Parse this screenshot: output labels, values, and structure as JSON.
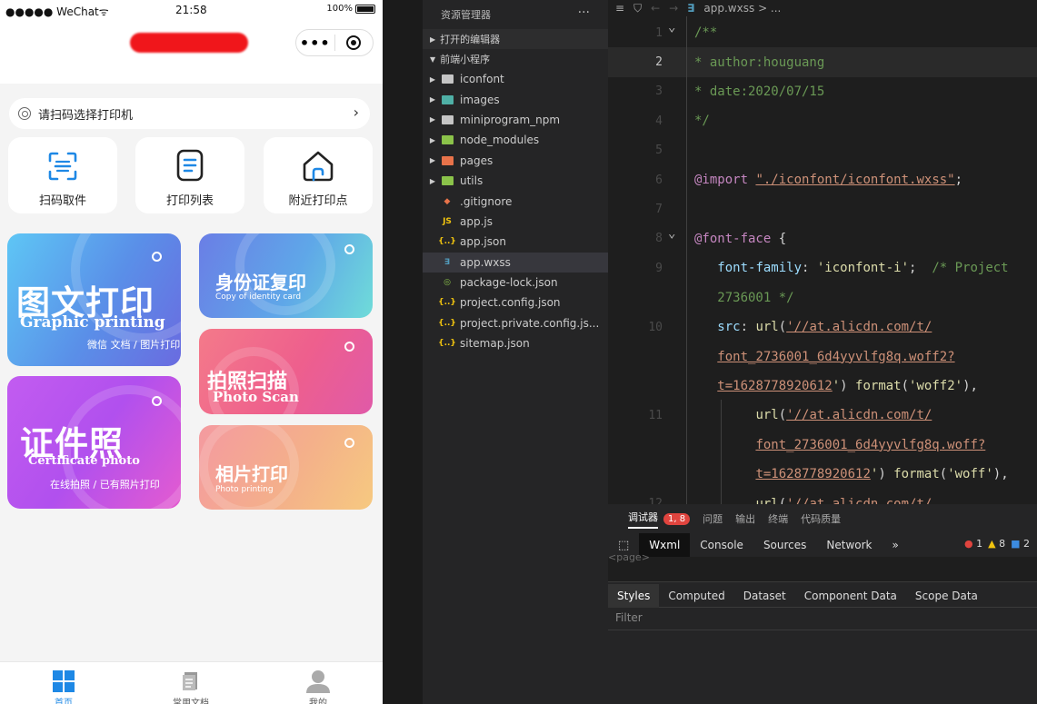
{
  "phone": {
    "status": {
      "carrier": "●●●●● WeChat",
      "wifi": "ᯤ",
      "time": "21:58",
      "battery": "100%"
    },
    "capsule": {
      "dots": "•••"
    },
    "scan_bar": {
      "text": "请扫码选择打印机",
      "chevron": "›"
    },
    "features": [
      {
        "label": "扫码取件",
        "icon": "scan-icon"
      },
      {
        "label": "打印列表",
        "icon": "list-icon"
      },
      {
        "label": "附近打印点",
        "icon": "home-icon"
      }
    ],
    "cards": {
      "graphic": {
        "title": "图文打印",
        "subtitle": "Graphic printing",
        "desc": "微信 文档 / 图片打印"
      },
      "idcopy": {
        "title": "身份证复印",
        "subtitle": "Copy of identity card"
      },
      "photoscan": {
        "title": "拍照扫描",
        "subtitle": "Photo Scan"
      },
      "certificate": {
        "title": "证件照",
        "subtitle": "Certificate photo",
        "desc": "在线拍照 / 已有照片打印"
      },
      "photoprint": {
        "title": "相片打印",
        "subtitle": "Photo printing"
      }
    },
    "tabs": [
      {
        "label": "首页",
        "active": true
      },
      {
        "label": "常用文档",
        "active": false
      },
      {
        "label": "我的",
        "active": false
      }
    ]
  },
  "explorer": {
    "title": "资源管理器",
    "more": "···",
    "open_editors": "打开的编辑器",
    "project": "前端小程序",
    "items": [
      {
        "name": "iconfont",
        "type": "folder",
        "color": "#c5c5c5"
      },
      {
        "name": "images",
        "type": "folder",
        "color": "#4fb0a6"
      },
      {
        "name": "miniprogram_npm",
        "type": "folder",
        "color": "#c5c5c5"
      },
      {
        "name": "node_modules",
        "type": "folder",
        "color": "#8bc34a"
      },
      {
        "name": "pages",
        "type": "folder",
        "color": "#e8734a"
      },
      {
        "name": "utils",
        "type": "folder",
        "color": "#8bc34a"
      },
      {
        "name": ".gitignore",
        "type": "file",
        "icon": "◆",
        "color": "#e8734a"
      },
      {
        "name": "app.js",
        "type": "file",
        "icon": "JS",
        "color": "#f1c40f"
      },
      {
        "name": "app.json",
        "type": "file",
        "icon": "{..}",
        "color": "#f1c40f"
      },
      {
        "name": "app.wxss",
        "type": "file",
        "icon": "∃",
        "color": "#519aba",
        "selected": true
      },
      {
        "name": "package-lock.json",
        "type": "file",
        "icon": "◎",
        "color": "#8bc34a"
      },
      {
        "name": "project.config.json",
        "type": "file",
        "icon": "{..}",
        "color": "#f1c40f"
      },
      {
        "name": "project.private.config.js...",
        "type": "file",
        "icon": "{..}",
        "color": "#f1c40f"
      },
      {
        "name": "sitemap.json",
        "type": "file",
        "icon": "{..}",
        "color": "#f1c40f"
      }
    ]
  },
  "editor": {
    "breadcrumb": {
      "file": "app.wxss",
      "rest": "> ..."
    },
    "lines": [
      {
        "n": "1",
        "fold": true,
        "parts": [
          [
            "c-com",
            "/**"
          ]
        ]
      },
      {
        "n": "2",
        "current": true,
        "parts": [
          [
            "c-com",
            "* author:houguang"
          ]
        ]
      },
      {
        "n": "3",
        "parts": [
          [
            "c-com",
            "* date:2020/07/15"
          ]
        ]
      },
      {
        "n": "4",
        "parts": [
          [
            "c-com",
            "*/"
          ]
        ]
      },
      {
        "n": "5",
        "parts": []
      },
      {
        "n": "6",
        "parts": [
          [
            "c-kw",
            "@import"
          ],
          [
            "c-punc",
            " "
          ],
          [
            "c-str",
            "\"./iconfont/iconfont.wxss\""
          ],
          [
            "c-punc",
            ";"
          ]
        ]
      },
      {
        "n": "7",
        "parts": []
      },
      {
        "n": "8",
        "fold": true,
        "parts": [
          [
            "c-kw",
            "@font-face"
          ],
          [
            "c-punc",
            " {"
          ]
        ]
      },
      {
        "n": "9",
        "parts": [
          [
            "c-punc",
            "   "
          ],
          [
            "c-prop",
            "font-family"
          ],
          [
            "c-punc",
            ": "
          ],
          [
            "c-fn",
            "'iconfont-i'"
          ],
          [
            "c-punc",
            ";  "
          ],
          [
            "c-com",
            "/* Project"
          ]
        ]
      },
      {
        "n": "",
        "parts": [
          [
            "c-com",
            "   2736001 */"
          ]
        ]
      },
      {
        "n": "10",
        "parts": [
          [
            "c-punc",
            "   "
          ],
          [
            "c-prop",
            "src"
          ],
          [
            "c-punc",
            ": "
          ],
          [
            "c-fn",
            "url"
          ],
          [
            "c-punc",
            "("
          ],
          [
            "c-str",
            "'//at.alicdn.com/t/"
          ]
        ]
      },
      {
        "n": "",
        "parts": [
          [
            "c-punc",
            "   "
          ],
          [
            "c-str",
            "font_2736001_6d4yyvlfg8q.woff2?"
          ]
        ]
      },
      {
        "n": "",
        "parts": [
          [
            "c-punc",
            "   "
          ],
          [
            "c-str",
            "t=1628778920612"
          ],
          [
            "c-fn",
            "'"
          ],
          [
            "c-punc",
            ") "
          ],
          [
            "c-fn",
            "format"
          ],
          [
            "c-punc",
            "("
          ],
          [
            "c-fn",
            "'woff2'"
          ],
          [
            "c-punc",
            "),"
          ]
        ]
      },
      {
        "n": "11",
        "parts": [
          [
            "c-punc",
            "        "
          ],
          [
            "c-fn",
            "url"
          ],
          [
            "c-punc",
            "("
          ],
          [
            "c-str",
            "'//at.alicdn.com/t/"
          ]
        ]
      },
      {
        "n": "",
        "parts": [
          [
            "c-punc",
            "        "
          ],
          [
            "c-str",
            "font_2736001_6d4yyvlfg8q.woff?"
          ]
        ]
      },
      {
        "n": "",
        "parts": [
          [
            "c-punc",
            "        "
          ],
          [
            "c-str",
            "t=1628778920612"
          ],
          [
            "c-fn",
            "'"
          ],
          [
            "c-punc",
            ") "
          ],
          [
            "c-fn",
            "format"
          ],
          [
            "c-punc",
            "("
          ],
          [
            "c-fn",
            "'woff'"
          ],
          [
            "c-punc",
            "),"
          ]
        ]
      },
      {
        "n": "12",
        "parts": [
          [
            "c-punc",
            "        "
          ],
          [
            "c-fn",
            "url"
          ],
          [
            "c-punc",
            "("
          ],
          [
            "c-str",
            "'//at.alicdn.com/t/"
          ]
        ]
      }
    ]
  },
  "debug": {
    "tabs": [
      "调试器",
      "问题",
      "输出",
      "终端",
      "代码质量"
    ],
    "badge": "1, 8",
    "toolbar": [
      "Wxml",
      "Console",
      "Sources",
      "Network",
      "»"
    ],
    "counts": {
      "errors": "1",
      "warnings": "8",
      "info": "2"
    },
    "page_tag": "<page>",
    "style_tabs": [
      "Styles",
      "Computed",
      "Dataset",
      "Component Data",
      "Scope Data"
    ],
    "filter": "Filter"
  }
}
